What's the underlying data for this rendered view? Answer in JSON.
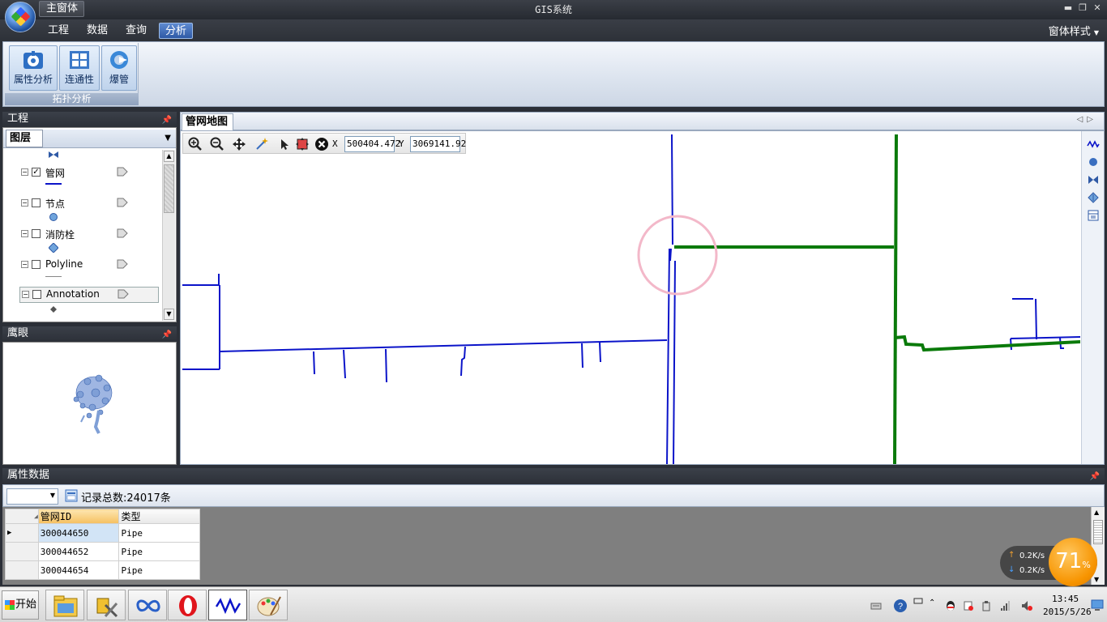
{
  "window": {
    "tab_label": "主窗体",
    "title": "GIS系统",
    "controls": [
      "minimize-icon",
      "restore-icon",
      "close-icon"
    ]
  },
  "menu": {
    "items": [
      {
        "label": "工程"
      },
      {
        "label": "数据"
      },
      {
        "label": "查询"
      },
      {
        "label": "分析",
        "active": true
      }
    ],
    "style_label": "窗体样式"
  },
  "ribbon": {
    "buttons": [
      {
        "label": "属性分析",
        "icon": "gear-icon"
      },
      {
        "label": "连通性",
        "icon": "grid-icon"
      },
      {
        "label": "爆管",
        "icon": "refresh-arrow-icon"
      }
    ],
    "group_label": "拓扑分析"
  },
  "project_panel": {
    "title": "工程",
    "tab_label": "图层",
    "layers": [
      {
        "name": "管网",
        "checked": true,
        "symbol": "blue-line"
      },
      {
        "name": "节点",
        "checked": false,
        "symbol": "blue-circle"
      },
      {
        "name": "消防栓",
        "checked": false,
        "symbol": "hydrant-diamond"
      },
      {
        "name": "Polyline",
        "checked": false,
        "symbol": "gray-line"
      },
      {
        "name": "Annotation",
        "checked": false,
        "symbol": "gray-diamond",
        "selected": true
      }
    ]
  },
  "overview_panel": {
    "title": "鹰眼"
  },
  "map": {
    "tab_label": "管网地图",
    "toolbar": {
      "tools": [
        "zoom-in-icon",
        "zoom-out-icon",
        "pan-icon",
        "magic-icon",
        "select-arrow-icon",
        "full-extent-icon",
        "clear-icon"
      ],
      "x_label": "X",
      "x_value": "500404.472",
      "y_label": "Y",
      "y_value": "3069141.92"
    },
    "side_tools": [
      "polyline-icon",
      "circle-icon",
      "valve-icon",
      "hydrant-icon",
      "table-icon"
    ],
    "colors": {
      "pipe": "#0b14c9",
      "burst_path": "#0a7a0a",
      "highlight": "#f3b8c9"
    }
  },
  "attribute_panel": {
    "title": "属性数据",
    "record_count": "记录总数:24017条",
    "columns": [
      "管网ID",
      "类型"
    ],
    "rows": [
      [
        "300044650",
        "Pipe"
      ],
      [
        "300044652",
        "Pipe"
      ],
      [
        "300044654",
        "Pipe"
      ]
    ]
  },
  "net_monitor": {
    "upload": "0.2K/s",
    "download": "0.2K/s",
    "percent": "71",
    "percent_sign": "%"
  },
  "taskbar": {
    "start_label": "开始",
    "apps": [
      "file-explorer-icon",
      "tools-icon",
      "infinity-icon",
      "opera-icon",
      "gis-wave-icon",
      "paint-icon"
    ],
    "clock_time": "13:45",
    "clock_date": "2015/5/26"
  }
}
